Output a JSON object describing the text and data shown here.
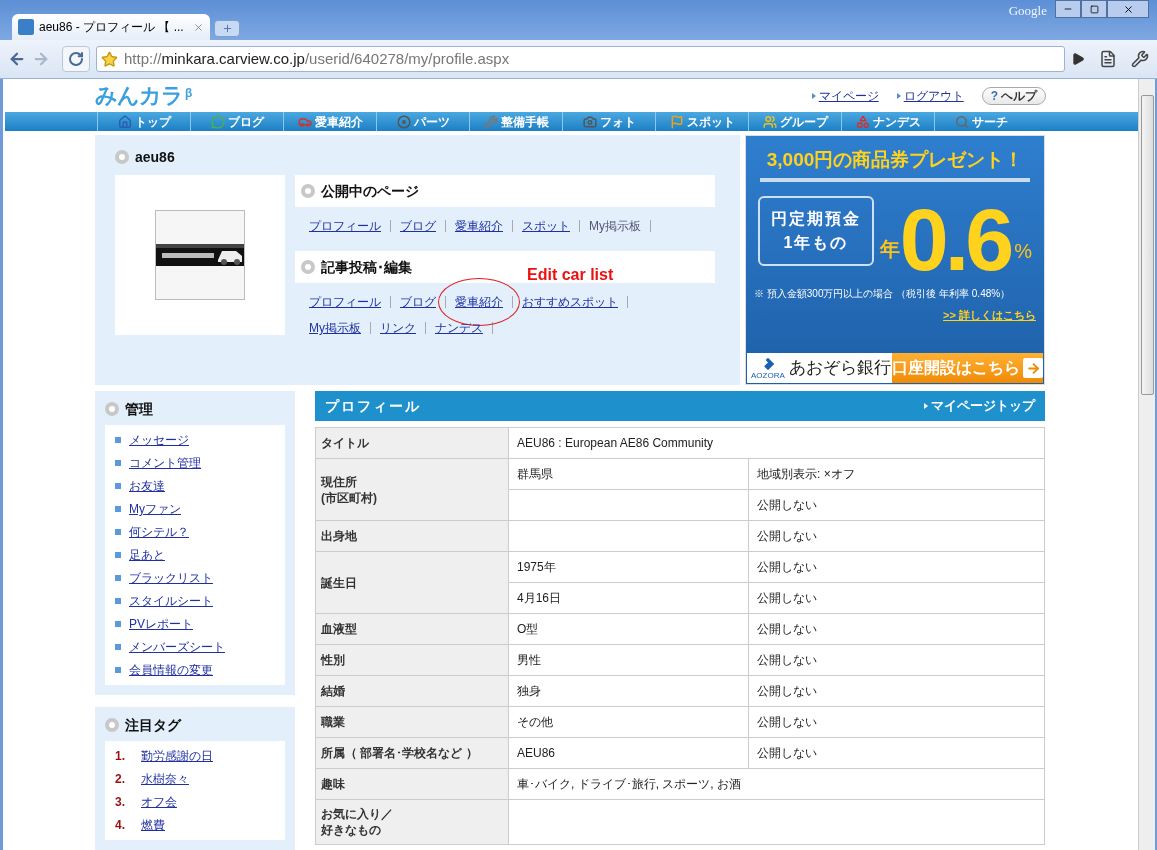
{
  "browser": {
    "tab_title": "aeu86 - プロフィール 【 ...",
    "brand": "Google",
    "url": {
      "scheme": "http://",
      "host": "minkara.carview.co.jp",
      "path": "/userid/640278/my/profile.aspx"
    }
  },
  "site": {
    "logo": "みんカラ",
    "logo_mark": "β",
    "header_links": [
      "マイページ",
      "ログアウト"
    ],
    "help_mark": "?",
    "help": "ヘルプ"
  },
  "nav": [
    {
      "label": "トップ"
    },
    {
      "label": "ブログ"
    },
    {
      "label": "愛車紹介"
    },
    {
      "label": "パーツ"
    },
    {
      "label": "整備手帳"
    },
    {
      "label": "フォト"
    },
    {
      "label": "スポット"
    },
    {
      "label": "グループ"
    },
    {
      "label": "ナンデス"
    },
    {
      "label": "サーチ"
    }
  ],
  "user": {
    "name": "aeu86"
  },
  "sections": [
    {
      "title": "公開中のページ",
      "links": [
        {
          "label": "プロフィール",
          "link": true,
          "circled": false
        },
        {
          "label": "ブログ",
          "link": true,
          "circled": false
        },
        {
          "label": "愛車紹介",
          "link": true,
          "circled": false
        },
        {
          "label": "スポット",
          "link": true,
          "circled": false
        },
        {
          "label": "My掲示板",
          "link": false,
          "circled": false
        }
      ]
    },
    {
      "title": "記事投稿･編集",
      "links": [
        {
          "label": "プロフィール",
          "link": true,
          "circled": false
        },
        {
          "label": "ブログ",
          "link": true,
          "circled": false
        },
        {
          "label": "愛車紹介",
          "link": true,
          "circled": true
        },
        {
          "label": "おすすめスポット",
          "link": true,
          "circled": false
        },
        {
          "label": "My掲示板",
          "link": true,
          "circled": false
        },
        {
          "label": "リンク",
          "link": true,
          "circled": false
        },
        {
          "label": "ナンデス",
          "link": true,
          "circled": false
        }
      ]
    }
  ],
  "annotation": {
    "text": "Edit car list"
  },
  "ad": {
    "headline": "3,000円の商品券プレゼント！",
    "product": [
      "円定期預金",
      "1年もの"
    ],
    "rate_prefix": "年",
    "rate": "0.6",
    "rate_unit": "%",
    "note": "※ 預入金額300万円以上の場合 （税引後 年利率 0.48%）",
    "details": ">> 詳しくはこちら",
    "bank": "あおぞら銀行",
    "bank_mark": "AOZORA",
    "cta": "口座開設はこちら"
  },
  "sidebar": [
    {
      "title": "管理",
      "kind": "bullets",
      "items": [
        {
          "label": "メッセージ"
        },
        {
          "label": "コメント管理"
        },
        {
          "label": "お友達"
        },
        {
          "label": "Myファン"
        },
        {
          "label": "何シテル？"
        },
        {
          "label": "足あと"
        },
        {
          "label": "ブラックリスト"
        },
        {
          "label": "スタイルシート"
        },
        {
          "label": "PVレポート"
        },
        {
          "label": "メンバーズシート"
        },
        {
          "label": "会員情報の変更"
        }
      ]
    },
    {
      "title": "注目タグ",
      "kind": "ranked",
      "items": [
        {
          "rank": "1.",
          "label": "勤労感謝の日"
        },
        {
          "rank": "2.",
          "label": "水樹奈々"
        },
        {
          "rank": "3.",
          "label": "オフ会"
        },
        {
          "rank": "4.",
          "label": "燃費"
        }
      ]
    }
  ],
  "profile": {
    "title": "プロフィール",
    "top_link": "マイページトップ",
    "rows": [
      {
        "label": "タイトル",
        "kind": "wide",
        "lines": [
          {
            "value": "AEU86 : European AE86 Community"
          }
        ]
      },
      {
        "label": [
          "現住所",
          "(市区町村)"
        ],
        "kind": "split",
        "lines": [
          {
            "value": "群馬県",
            "setting": "地域別表示: ×オフ"
          },
          {
            "setting": "公開しない"
          }
        ]
      },
      {
        "label": "出身地",
        "kind": "split",
        "lines": [
          {
            "setting": "公開しない"
          }
        ]
      },
      {
        "label": "誕生日",
        "kind": "split",
        "lines": [
          {
            "value": "1975年",
            "setting": "公開しない"
          },
          {
            "value": "4月16日",
            "setting": "公開しない"
          }
        ]
      },
      {
        "label": "血液型",
        "kind": "split",
        "lines": [
          {
            "value": "O型",
            "setting": "公開しない"
          }
        ]
      },
      {
        "label": "性別",
        "kind": "split",
        "lines": [
          {
            "value": "男性",
            "setting": "公開しない"
          }
        ]
      },
      {
        "label": "結婚",
        "kind": "split",
        "lines": [
          {
            "value": "独身",
            "setting": "公開しない"
          }
        ]
      },
      {
        "label": "職業",
        "kind": "split",
        "lines": [
          {
            "value": "その他",
            "setting": "公開しない"
          }
        ]
      },
      {
        "label": "所属（ 部署名･学校名など ）",
        "kind": "split",
        "lines": [
          {
            "value": "AEU86",
            "setting": "公開しない"
          }
        ]
      },
      {
        "label": "趣味",
        "kind": "wide",
        "lines": [
          {
            "value": "車･バイク, ドライブ･旅行, スポーツ, お酒"
          }
        ]
      },
      {
        "label": [
          "お気に入り／",
          "好きなもの"
        ],
        "kind": "wide"
      }
    ]
  }
}
